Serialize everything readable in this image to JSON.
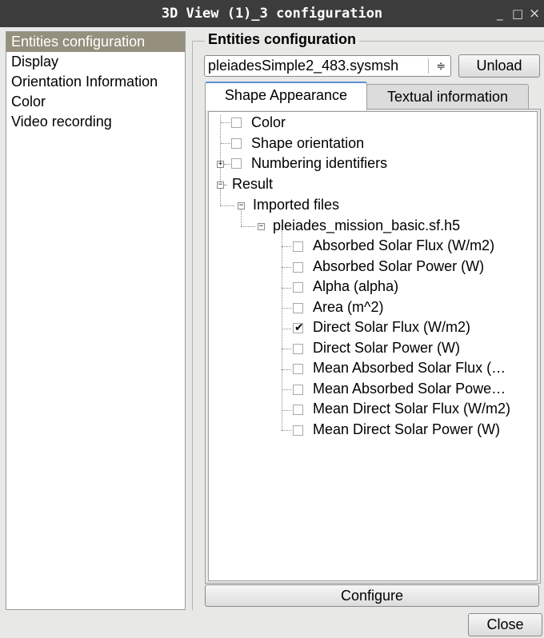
{
  "window": {
    "title": "3D View (1)_3 configuration",
    "minimize_glyph": "_",
    "maximize_glyph": "□",
    "close_glyph": "×"
  },
  "sidebar": {
    "items": [
      {
        "label": "Entities configuration",
        "selected": true
      },
      {
        "label": "Display"
      },
      {
        "label": "Orientation Information"
      },
      {
        "label": "Color"
      },
      {
        "label": "Video recording"
      }
    ]
  },
  "group": {
    "title": "Entities configuration"
  },
  "entity_select": {
    "value": "pleiadesSimple2_483.sysmsh",
    "arrow": "≑"
  },
  "unload_button": "Unload",
  "tabs": [
    {
      "label": "Shape Appearance",
      "active": true
    },
    {
      "label": "Textual information",
      "active": false
    }
  ],
  "tree": {
    "color": {
      "label": "Color",
      "checked": false
    },
    "shape_orientation": {
      "label": "Shape orientation",
      "checked": false
    },
    "numbering": {
      "label": "Numbering identifiers",
      "checked": false,
      "expander": "+"
    },
    "result": {
      "label": "Result",
      "expander": "−"
    },
    "imported": {
      "label": "Imported files",
      "expander": "−"
    },
    "file": {
      "label": "pleiades_mission_basic.sf.h5",
      "expander": "−"
    },
    "fields": [
      {
        "label": "Absorbed Solar Flux (W/m2)",
        "checked": false
      },
      {
        "label": "Absorbed Solar Power (W)",
        "checked": false
      },
      {
        "label": "Alpha (alpha)",
        "checked": false
      },
      {
        "label": "Area (m^2)",
        "checked": false
      },
      {
        "label": "Direct Solar Flux (W/m2)",
        "checked": true
      },
      {
        "label": "Direct Solar Power (W)",
        "checked": false
      },
      {
        "label": "Mean Absorbed Solar Flux (…",
        "checked": false
      },
      {
        "label": "Mean Absorbed Solar Powe…",
        "checked": false
      },
      {
        "label": "Mean Direct Solar Flux (W/m2)",
        "checked": false
      },
      {
        "label": "Mean Direct Solar Power (W)",
        "checked": false
      }
    ]
  },
  "configure_button": "Configure",
  "close_button": "Close"
}
